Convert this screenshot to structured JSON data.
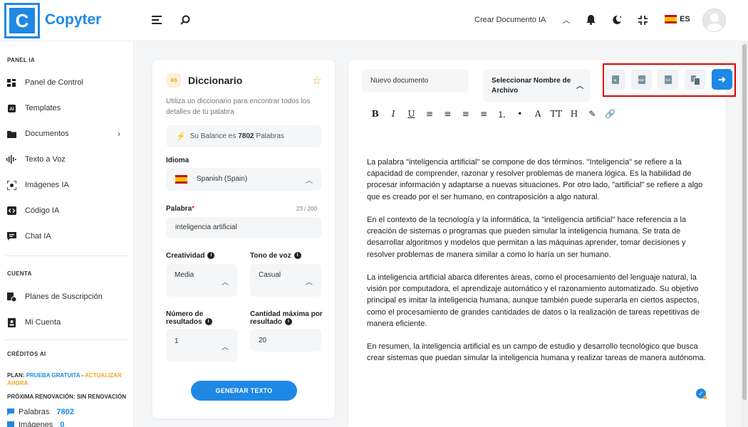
{
  "brand": {
    "logo_letter": "C",
    "name": "Copyter"
  },
  "header": {
    "create_doc_label": "Crear Documento IA",
    "language_code": "ES"
  },
  "sidebar": {
    "sections": {
      "panel": "PANEL IA",
      "account": "CUENTA",
      "credits": "CRÉDITOS AI"
    },
    "items": [
      {
        "label": "Panel de Control",
        "icon": "dashboard-icon"
      },
      {
        "label": "Templates",
        "icon": "ai-icon"
      },
      {
        "label": "Documentos",
        "icon": "folder-icon"
      },
      {
        "label": "Texto a Voz",
        "icon": "waveform-icon"
      },
      {
        "label": "Imágenes IA",
        "icon": "image-icon"
      },
      {
        "label": "Código IA",
        "icon": "code-icon"
      },
      {
        "label": "Chat IA",
        "icon": "chat-icon"
      }
    ],
    "account_items": [
      {
        "label": "Planes de Suscripción",
        "icon": "subscription-icon"
      },
      {
        "label": "Mi Cuenta",
        "icon": "account-icon"
      }
    ],
    "plan": {
      "prefix": "PLAN:",
      "free": "PRUEBA GRATUITA",
      "sep": " - ",
      "upgrade": "ACTUALIZAR AHORA",
      "renewal": "PRÓXIMA RENOVACIÓN: SIN RENOVACIÓN"
    },
    "credits": [
      {
        "label": "Palabras",
        "value": "7802"
      },
      {
        "label": "Imágenes",
        "value": "0"
      }
    ]
  },
  "dictionary": {
    "icon_text": "AS",
    "title": "Diccionario",
    "description": "Utiliza un diccionario para encontrar todos los detalles de tu palabra",
    "balance_prefix": "Su Balance es",
    "balance_value": "7802",
    "balance_suffix": "Palabras",
    "language_label": "Idioma",
    "language_value": "Spanish (Spain)",
    "word_label": "Palabra",
    "word_required": "*",
    "word_counter": "23 / 200",
    "word_value": "inteligencia artificial",
    "creativity_label": "Creatividad",
    "creativity_value": "Media",
    "tone_label": "Tono de voz",
    "tone_value": "Casual",
    "results_label": "Número de resultados",
    "results_value": "1",
    "max_qty_label": "Cantidad máxima por resultado",
    "max_qty_value": "20",
    "generate_label": "GENERAR TEXTO"
  },
  "editor": {
    "doc_name": "Nuevo documento",
    "file_select": "Seleccionar Nombre de Archivo",
    "export_buttons": [
      "W",
      "PDF",
      "TXT"
    ],
    "format_tools": [
      "B",
      "I",
      "U",
      "≡",
      "≡",
      "≡",
      "≡",
      "⒈",
      "•",
      "A",
      "TT",
      "H",
      "✎",
      "🔗"
    ],
    "paragraphs": [
      "La palabra \"inteligencia artificial\" se compone de dos términos. \"Inteligencia\" se refiere a la capacidad de comprender, razonar y resolver problemas de manera lógica. Es la habilidad de procesar información y adaptarse a nuevas situaciones. Por otro lado, \"artificial\" se refiere a algo que es creado por el ser humano, en contraposición a algo natural.",
      "En el contexto de la tecnología y la informática, la \"inteligencia artificial\" hace referencia a la creación de sistemas o programas que pueden simular la inteligencia humana. Se trata de desarrollar algoritmos y modelos que permitan a las máquinas aprender, tomar decisiones y resolver problemas de manera similar a como lo haría un ser humano.",
      "La inteligencia artificial abarca diferentes áreas, como el procesamiento del lenguaje natural, la visión por computadora, el aprendizaje automático y el razonamiento automatizado. Su objetivo principal es imitar la inteligencia humana, aunque también puede superarla en ciertos aspectos, como el procesamiento de grandes cantidades de datos o la realización de tareas repetitivas de manera eficiente.",
      "En resumen, la inteligencia artificial es un campo de estudio y desarrollo tecnológico que busca crear sistemas que puedan simular la inteligencia humana y realizar tareas de manera autónoma."
    ]
  },
  "colors": {
    "accent": "#1e88e5",
    "highlight": "#e10000",
    "upgrade": "#f5a623"
  }
}
